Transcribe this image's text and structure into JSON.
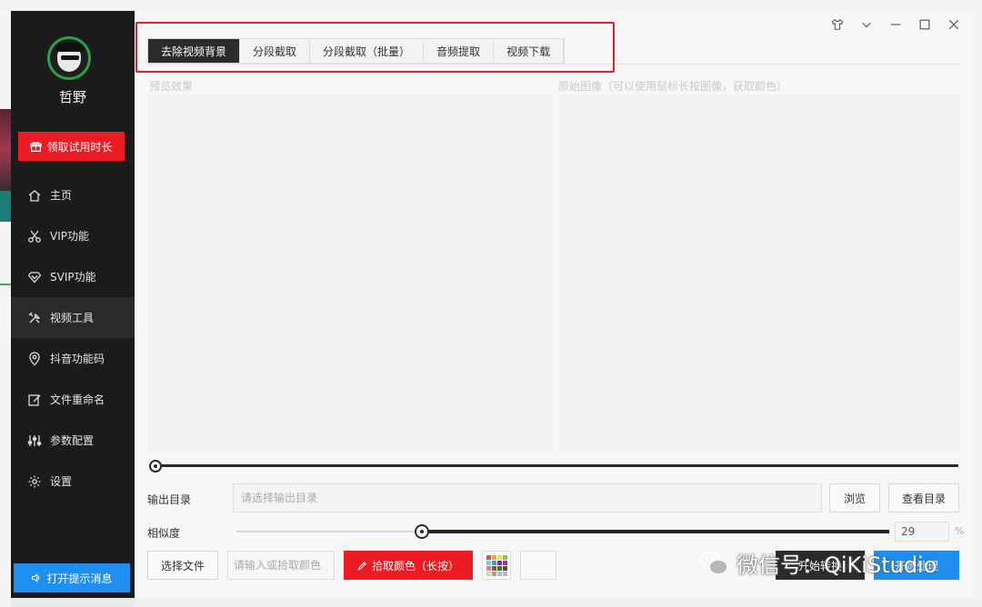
{
  "sidebar": {
    "username": "哲野",
    "trial_button": "领取试用时长",
    "items": [
      {
        "label": "主页",
        "icon": "home-icon"
      },
      {
        "label": "VIP功能",
        "icon": "scissors-icon"
      },
      {
        "label": "SVIP功能",
        "icon": "diamond-icon"
      },
      {
        "label": "视频工具",
        "icon": "tools-icon"
      },
      {
        "label": "抖音功能码",
        "icon": "location-pin-icon"
      },
      {
        "label": "文件重命名",
        "icon": "edit-icon"
      },
      {
        "label": "参数配置",
        "icon": "sliders-icon"
      },
      {
        "label": "设置",
        "icon": "gear-icon"
      }
    ],
    "active_item": "视频工具",
    "notify_button": "打开提示消息"
  },
  "tabs": [
    {
      "label": "去除视频背景"
    },
    {
      "label": "分段截取"
    },
    {
      "label": "分段截取（批量）"
    },
    {
      "label": "音频提取"
    },
    {
      "label": "视频下载"
    }
  ],
  "active_tab": "去除视频背景",
  "panels": {
    "preview_label": "预览效果",
    "original_label": "原始图像（可以使用鼠标长按图像，获取颜色）"
  },
  "output": {
    "label": "输出目录",
    "placeholder": "请选择输出目录",
    "browse_button": "浏览",
    "view_button": "查看目录"
  },
  "similarity": {
    "label": "相似度",
    "value": "29",
    "unit": "%",
    "fraction": 0.29
  },
  "actions": {
    "select_file": "选择文件",
    "color_placeholder": "请输入或拾取颜色",
    "pick_color": "拾取颜色（长按）",
    "start_button": "开始转换",
    "process_button": "开始处理"
  },
  "watermark": "微信号：QiKiStudio",
  "colors": {
    "accent_red": "#ec1c24",
    "accent_blue": "#1e8ff0",
    "sidebar_bg": "#1b1b1b",
    "avatar_ring": "#2f9e49"
  }
}
